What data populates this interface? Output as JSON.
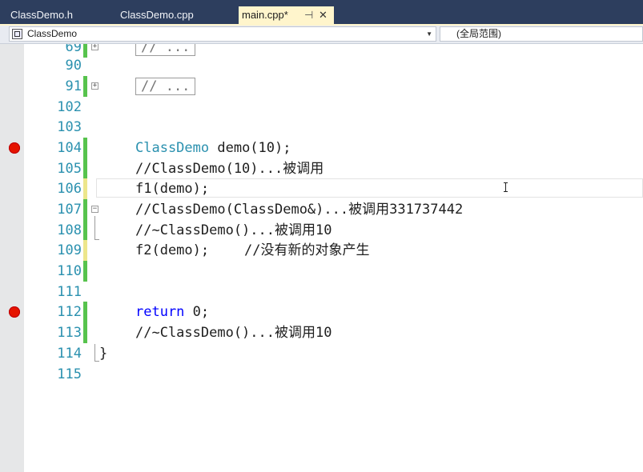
{
  "tabs": [
    {
      "label": "ClassDemo.h",
      "active": false
    },
    {
      "label": "ClassDemo.cpp",
      "active": false
    },
    {
      "label": "main.cpp*",
      "active": true
    }
  ],
  "tab_icons": {
    "pin": "pin-icon",
    "close": "close-icon"
  },
  "nav": {
    "class_combo": "ClassDemo",
    "scope_combo": "(全局范围)"
  },
  "colors": {
    "line_number": "#2b91af",
    "type": "#2b91af",
    "keyword": "#0000ff",
    "comment": "#008000",
    "change_saved": "#57c34d",
    "change_unsaved": "#ede68b",
    "breakpoint": "#e51400"
  },
  "lines": [
    {
      "num": "69",
      "text": "// ..."
    },
    {
      "num": "90",
      "text": ""
    },
    {
      "num": "91",
      "text": "// ..."
    },
    {
      "num": "102",
      "text": ""
    },
    {
      "num": "103",
      "text": ""
    },
    {
      "num": "104",
      "text_type": "ClassDemo",
      "text_rest": " demo(10);"
    },
    {
      "num": "105",
      "text": "//ClassDemo(10)...被调用"
    },
    {
      "num": "106",
      "text": "f1(demo);"
    },
    {
      "num": "107",
      "text": "//ClassDemo(ClassDemo&)...被调用331737442"
    },
    {
      "num": "108",
      "text": "//~ClassDemo()...被调用10"
    },
    {
      "num": "109",
      "text_code": "f2(demo);",
      "text_comment": "//没有新的对象产生"
    },
    {
      "num": "110",
      "text": ""
    },
    {
      "num": "111",
      "text": ""
    },
    {
      "num": "112",
      "text_kw": "return",
      "text_rest": " 0;"
    },
    {
      "num": "113",
      "text": "//~ClassDemo()...被调用10"
    },
    {
      "num": "114",
      "text": "}"
    },
    {
      "num": "115",
      "text": ""
    }
  ]
}
